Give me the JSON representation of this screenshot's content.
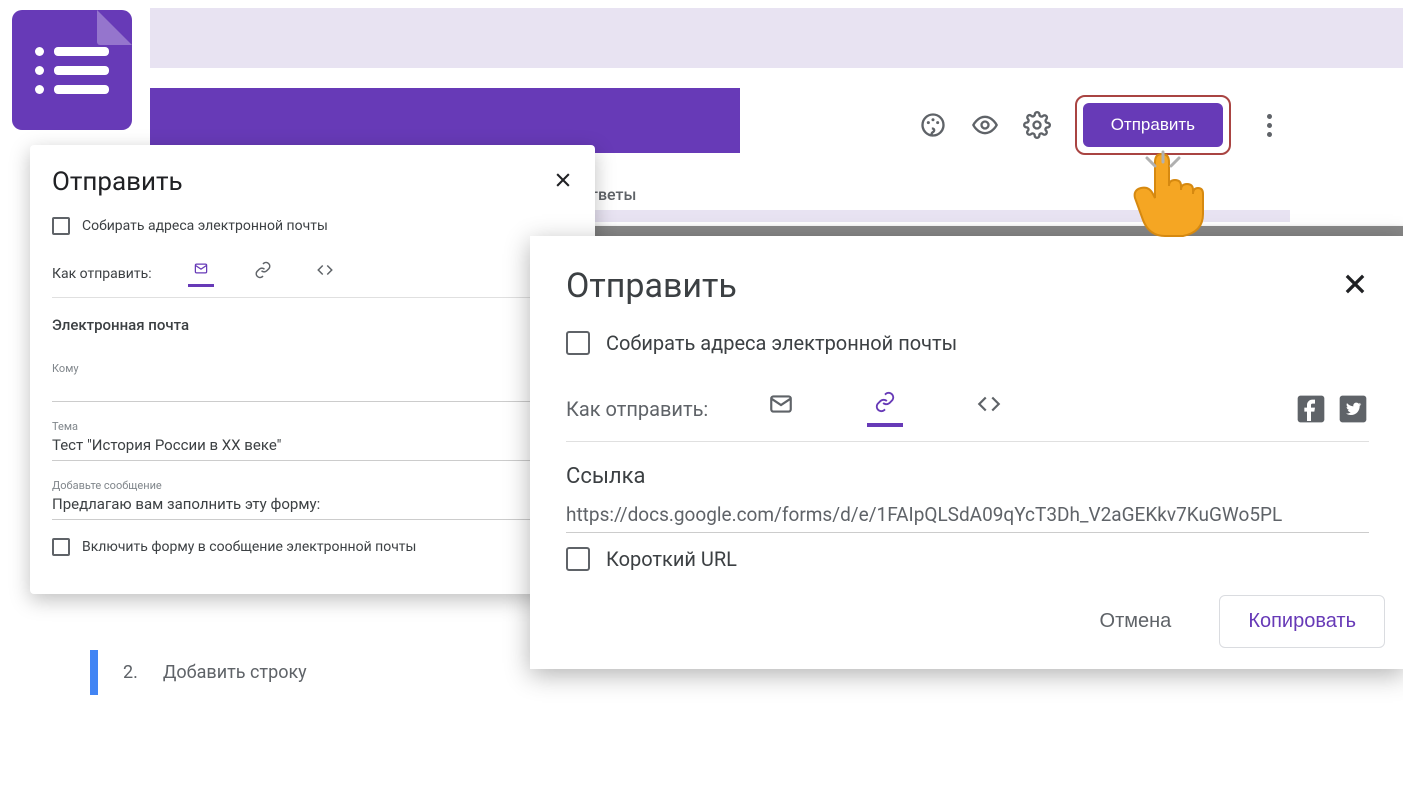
{
  "toolbar": {
    "send_label": "Отправить"
  },
  "tab_remnant": "тветы",
  "dialog1": {
    "title": "Отправить",
    "collect_emails": "Собирать адреса электронной почты",
    "how_label": "Как отправить:",
    "section_email": "Электронная почта",
    "to_label": "Кому",
    "to_value": "",
    "subject_label": "Тема",
    "subject_value": "Тест \"История России в XX веке\"",
    "message_label": "Добавьте сообщение",
    "message_value": "Предлагаю вам заполнить эту форму:",
    "include_form": "Включить форму в сообщение электронной почты"
  },
  "step": {
    "num": "2.",
    "text": "Добавить строку"
  },
  "dialog2": {
    "title": "Отправить",
    "collect_emails": "Собирать адреса электронной почты",
    "how_label": "Как отправить:",
    "link_section": "Ссылка",
    "link_value": "https://docs.google.com/forms/d/e/1FAIpQLSdA09qYcT3Dh_V2aGEKkv7KuGWo5PL",
    "short_url": "Короткий URL",
    "cancel": "Отмена",
    "copy": "Копировать"
  }
}
